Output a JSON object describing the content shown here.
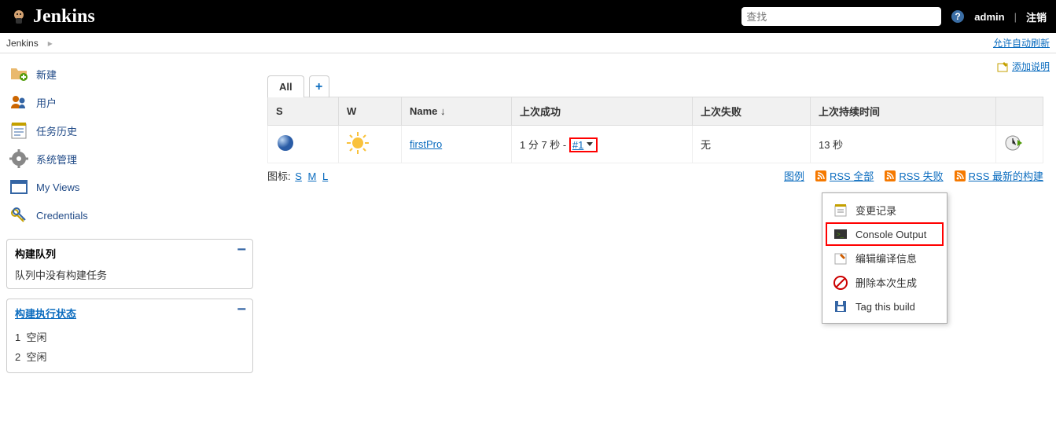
{
  "header": {
    "brand": "Jenkins",
    "search_placeholder": "查找",
    "user_link": "admin",
    "logout": "注销"
  },
  "topstrip": {
    "breadcrumb": "Jenkins",
    "auto_refresh": "允许自动刷新"
  },
  "sidebar": {
    "items": [
      {
        "label": "新建"
      },
      {
        "label": "用户"
      },
      {
        "label": "任务历史"
      },
      {
        "label": "系统管理"
      },
      {
        "label": "My Views"
      },
      {
        "label": "Credentials"
      }
    ],
    "queue_title": "构建队列",
    "queue_empty": "队列中没有构建任务",
    "exec_title": "构建执行状态",
    "executors": [
      {
        "num": "1",
        "state": "空闲"
      },
      {
        "num": "2",
        "state": "空闲"
      }
    ]
  },
  "main": {
    "add_description": "添加说明",
    "tabs": {
      "all": "All"
    },
    "columns": {
      "s": "S",
      "w": "W",
      "name": "Name ↓",
      "last_success": "上次成功",
      "last_fail": "上次失败",
      "last_duration": "上次持续时间"
    },
    "row": {
      "project": "firstPro",
      "last_success_text": "1 分 7 秒",
      "build_link": "#1",
      "last_fail": "无",
      "duration": "13 秒"
    },
    "legend_label": "图标:",
    "legend_s": "S",
    "legend_m": "M",
    "legend_l": "L",
    "legend_link": "图例",
    "rss_all": "RSS 全部",
    "rss_fail": "RSS 失败",
    "rss_latest": "RSS 最新的构建"
  },
  "menu": {
    "changelog": "变更记录",
    "console": "Console Output",
    "edit": "编辑编译信息",
    "delete": "删除本次生成",
    "tag": "Tag this build"
  }
}
